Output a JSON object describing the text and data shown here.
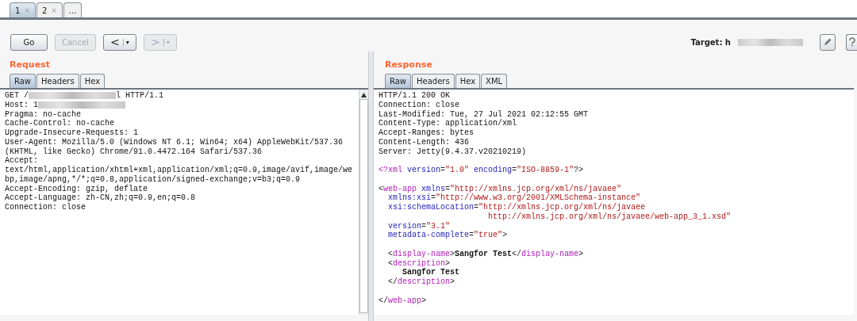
{
  "tabs": [
    {
      "label": "1",
      "close": "×",
      "selected": true
    },
    {
      "label": "2",
      "close": "×",
      "selected": false
    },
    {
      "label": "...",
      "selected": false
    }
  ],
  "toolbar": {
    "buttons": [
      {
        "kind": "text",
        "label": "Go",
        "disabled": false
      },
      {
        "kind": "text",
        "label": "Cancel",
        "disabled": true
      },
      {
        "kind": "nav",
        "label": "<",
        "menu": "▾",
        "disabled": false
      },
      {
        "kind": "nav",
        "label": ">",
        "menu": "▾",
        "disabled": true
      }
    ],
    "target_label": "Target: h"
  },
  "request": {
    "title": "Request",
    "tabs": [
      {
        "label": "Raw",
        "selected": true
      },
      {
        "label": "Headers",
        "selected": false
      },
      {
        "label": "Hex",
        "selected": false
      }
    ],
    "lines": [
      [
        {
          "kind": "text",
          "text": "GET /"
        },
        {
          "kind": "redacted"
        },
        {
          "kind": "text",
          "text": "l HTTP/1.1"
        }
      ],
      [
        {
          "kind": "text",
          "text": "Host: 1"
        },
        {
          "kind": "redacted"
        }
      ],
      [
        {
          "kind": "text",
          "text": "Pragma: no-cache"
        }
      ],
      [
        {
          "kind": "text",
          "text": "Cache-Control: no-cache"
        }
      ],
      [
        {
          "kind": "text",
          "text": "Upgrade-Insecure-Requests: 1"
        }
      ],
      [
        {
          "kind": "text",
          "text": "User-Agent: Mozilla/5.0 (Windows NT 6.1; Win64; x64) AppleWebKit/537.36"
        }
      ],
      [
        {
          "kind": "text",
          "text": "(KHTML, like Gecko) Chrome/91.0.4472.164 Safari/537.36"
        }
      ],
      [
        {
          "kind": "text",
          "text": "Accept:"
        }
      ],
      [
        {
          "kind": "text",
          "text": "text/html,application/xhtml+xml,application/xml;q=0.9,image/avif,image/we"
        }
      ],
      [
        {
          "kind": "text",
          "text": "bp,image/apng,*/*;q=0.8,application/signed-exchange;v=b3;q=0.9"
        }
      ],
      [
        {
          "kind": "text",
          "text": "Accept-Encoding: gzip, deflate"
        }
      ],
      [
        {
          "kind": "text",
          "text": "Accept-Language: zh-CN,zh;q=0.9,en;q=0.8"
        }
      ],
      [
        {
          "kind": "text",
          "text": "Connection: close"
        }
      ]
    ]
  },
  "response": {
    "title": "Response",
    "tabs": [
      {
        "label": "Raw",
        "selected": true
      },
      {
        "label": "Headers",
        "selected": false
      },
      {
        "label": "Hex",
        "selected": false
      },
      {
        "label": "XML",
        "selected": false
      }
    ],
    "lines": [
      [
        {
          "kind": "text",
          "text": "HTTP/1.1 200 OK"
        }
      ],
      [
        {
          "kind": "text",
          "text": "Connection: close"
        }
      ],
      [
        {
          "kind": "text",
          "text": "Last-Modified: Tue, 27 Jul 2021 02:12:55 GMT"
        }
      ],
      [
        {
          "kind": "text",
          "text": "Content-Type: application/xml"
        }
      ],
      [
        {
          "kind": "text",
          "text": "Accept-Ranges: bytes"
        }
      ],
      [
        {
          "kind": "text",
          "text": "Content-Length: 436"
        }
      ],
      [
        {
          "kind": "text",
          "text": "Server: Jetty(9.4.37.v20210219)"
        }
      ],
      [
        {
          "kind": "tag",
          "text": "<?xml",
          "space_before": true
        },
        {
          "kind": "attr",
          "text": " version"
        },
        {
          "kind": "punct",
          "text": "="
        },
        {
          "kind": "value",
          "text": "\"1.0\""
        },
        {
          "kind": "attr",
          "text": " encoding"
        },
        {
          "kind": "punct",
          "text": "="
        },
        {
          "kind": "value",
          "text": "\"ISO-8859-1\""
        },
        {
          "kind": "punct",
          "text": "?>"
        }
      ],
      [
        {
          "kind": "punct",
          "text": "<",
          "space_before": true
        },
        {
          "kind": "tag",
          "text": "web-app"
        },
        {
          "kind": "attr",
          "text": " xmlns"
        },
        {
          "kind": "punct",
          "text": "="
        },
        {
          "kind": "value",
          "text": "\"http://xmlns.jcp.org/xml/ns/javaee\""
        }
      ],
      [
        {
          "kind": "attr",
          "text": "  xmlns:xsi"
        },
        {
          "kind": "punct",
          "text": "="
        },
        {
          "kind": "value",
          "text": "\"http://www.w3.org/2001/XMLSchema-instance\""
        }
      ],
      [
        {
          "kind": "attr",
          "text": "  xsi:schemaLocation"
        },
        {
          "kind": "punct",
          "text": "="
        },
        {
          "kind": "value",
          "text": "\"http://xmlns.jcp.org/xml/ns/javaee"
        }
      ],
      [
        {
          "kind": "value",
          "text": "                       http://xmlns.jcp.org/xml/ns/javaee/web-app_3_1.xsd\""
        }
      ],
      [
        {
          "kind": "attr",
          "text": "  version"
        },
        {
          "kind": "punct",
          "text": "="
        },
        {
          "kind": "value",
          "text": "\"3.1\""
        }
      ],
      [
        {
          "kind": "attr",
          "text": "  metadata-complete"
        },
        {
          "kind": "punct",
          "text": "="
        },
        {
          "kind": "value",
          "text": "\"true\""
        },
        {
          "kind": "punct",
          "text": ">"
        }
      ],
      [
        {
          "kind": "punct",
          "text": "  <",
          "space_before": true
        },
        {
          "kind": "tag",
          "text": "display-name"
        },
        {
          "kind": "punct",
          "text": ">"
        },
        {
          "kind": "content",
          "text": "Sangfor Test"
        },
        {
          "kind": "punct",
          "text": "</"
        },
        {
          "kind": "tag",
          "text": "display-name"
        },
        {
          "kind": "punct",
          "text": ">"
        }
      ],
      [
        {
          "kind": "punct",
          "text": "  <"
        },
        {
          "kind": "tag",
          "text": "description"
        },
        {
          "kind": "punct",
          "text": ">"
        }
      ],
      [
        {
          "kind": "content",
          "text": "     Sangfor Test"
        }
      ],
      [
        {
          "kind": "punct",
          "text": "  </"
        },
        {
          "kind": "tag",
          "text": "description"
        },
        {
          "kind": "punct",
          "text": ">"
        }
      ],
      [
        {
          "kind": "punct",
          "text": "</",
          "space_before": true
        },
        {
          "kind": "tag",
          "text": "web-app"
        },
        {
          "kind": "punct",
          "text": ">"
        }
      ]
    ]
  }
}
